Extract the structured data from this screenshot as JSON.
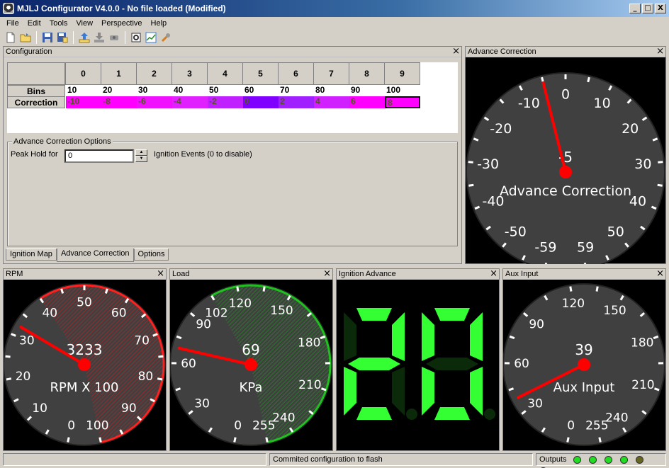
{
  "window": {
    "title": "MJLJ Configurator V4.0.0 - No file loaded (Modified)",
    "min": "_",
    "max": "□",
    "close": "X"
  },
  "menu": [
    "File",
    "Edit",
    "Tools",
    "View",
    "Perspective",
    "Help"
  ],
  "toolbar": {
    "icons": [
      "new-file-icon",
      "open-folder-icon",
      "save-icon",
      "save-as-icon",
      "upload-icon",
      "download-icon",
      "connect-icon",
      "settings-icon",
      "chart-icon",
      "wrench-icon"
    ]
  },
  "config": {
    "title": "Configuration",
    "columns": [
      "0",
      "1",
      "2",
      "3",
      "4",
      "5",
      "6",
      "7",
      "8",
      "9"
    ],
    "bins_label": "Bins",
    "correction_label": "Correction",
    "bins": [
      "10",
      "20",
      "30",
      "40",
      "50",
      "60",
      "70",
      "80",
      "90",
      "100"
    ],
    "correction": [
      "-10",
      "-8",
      "-6",
      "-4",
      "-2",
      "0",
      "2",
      "4",
      "6",
      "8"
    ],
    "correction_colors": [
      "#ff00ff",
      "#ff00ff",
      "#f010ff",
      "#e020ff",
      "#c020ff",
      "#8000ff",
      "#a020ff",
      "#d020ff",
      "#ff00ff",
      "#ff00ff"
    ],
    "options_title": "Advance Correction Options",
    "peak_hold_label": "Peak Hold for",
    "peak_hold_value": "0",
    "events_label": "Ignition Events (0 to disable)",
    "tabs": [
      "Ignition Map",
      "Advance Correction",
      "Options"
    ],
    "active_tab": 1
  },
  "gauges": {
    "advance": {
      "panel_title": "Advance Correction",
      "label": "Advance Correction",
      "readout": "-5",
      "value": -5,
      "min": -60,
      "max": 60,
      "ticks": [
        "-59",
        "-50",
        "-40",
        "-30",
        "-20",
        "-10",
        "0",
        "10",
        "20",
        "30",
        "40",
        "50",
        "59"
      ]
    },
    "rpm": {
      "panel_title": "RPM",
      "label": "RPM X 100",
      "readout": "3233",
      "value": 32.33,
      "min": 0,
      "max": 100,
      "ticks": [
        "0",
        "10",
        "20",
        "30",
        "40",
        "50",
        "60",
        "70",
        "80",
        "90",
        "100"
      ]
    },
    "load": {
      "panel_title": "Load",
      "label": "KPa",
      "readout": "69",
      "value": 69,
      "min": 0,
      "max": 255,
      "ticks": [
        "0",
        "30",
        "60",
        "90",
        "102",
        "120",
        "150",
        "180",
        "210",
        "240",
        "255"
      ]
    },
    "aux": {
      "panel_title": "Aux Input",
      "label": "Aux Input",
      "readout": "39",
      "value": 39,
      "min": 0,
      "max": 255,
      "ticks": [
        "0",
        "30",
        "60",
        "90",
        "120",
        "150",
        "180",
        "210",
        "240",
        "255"
      ]
    }
  },
  "ignition": {
    "panel_title": "Ignition Advance",
    "digits": [
      "2",
      "0"
    ],
    "segment_color": "#33ff33"
  },
  "status": {
    "left": "",
    "message": "Commited configuration to flash",
    "outputs_label": "Outputs",
    "leds": [
      "#22dd22",
      "#22dd22",
      "#22dd22",
      "#22dd22",
      "#666622",
      "#662222"
    ]
  }
}
